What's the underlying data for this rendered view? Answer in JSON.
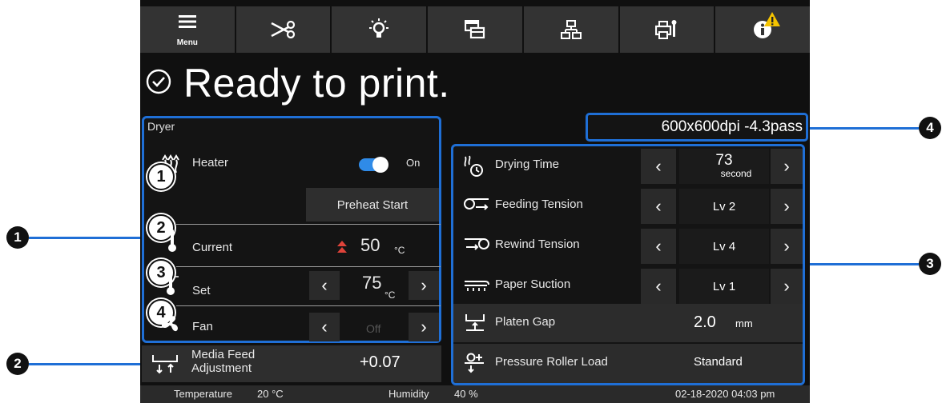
{
  "toolbar": {
    "menu_label": "Menu",
    "items": [
      {
        "icon": "menu-icon"
      },
      {
        "icon": "scissors-icon"
      },
      {
        "icon": "heater-lamp-icon"
      },
      {
        "icon": "media-settings-icon"
      },
      {
        "icon": "network-icon"
      },
      {
        "icon": "maintenance-icon"
      },
      {
        "icon": "info-icon"
      }
    ],
    "warning_icon": "warning-triangle-icon",
    "warning_color": "#f5c400"
  },
  "status": {
    "icon": "check-circle-icon",
    "text": "Ready to print."
  },
  "dryer": {
    "title": "Dryer",
    "heater": {
      "label": "Heater",
      "toggle_state": "On",
      "toggle_on": true
    },
    "preheat_button": "Preheat Start",
    "current": {
      "label": "Current",
      "value": "50",
      "unit": "°C"
    },
    "set": {
      "label": "Set",
      "value": "75",
      "unit": "°C"
    },
    "fan": {
      "label": "Fan",
      "value": "Off"
    }
  },
  "media_feed": {
    "label_line1": "Media Feed",
    "label_line2": "Adjustment",
    "value": "+0.07"
  },
  "resolution": "600x600dpi -4.3pass",
  "settings": {
    "drying_time": {
      "label": "Drying Time",
      "value": "73",
      "unit": "second"
    },
    "feeding_tension": {
      "label": "Feeding Tension",
      "value": "Lv 2"
    },
    "rewind_tension": {
      "label": "Rewind Tension",
      "value": "Lv 4"
    },
    "paper_suction": {
      "label": "Paper Suction",
      "value": "Lv 1"
    },
    "platen_gap": {
      "label": "Platen Gap",
      "value": "2.0",
      "unit": "mm"
    },
    "pressure_roller": {
      "label": "Pressure Roller Load",
      "value": "Standard"
    }
  },
  "footer": {
    "temperature_label": "Temperature",
    "temperature_value": "20 °C",
    "humidity_label": "Humidity",
    "humidity_value": "40 %",
    "datetime": "02-18-2020 04:03 pm"
  },
  "callouts": {
    "panel_numbers": [
      "1",
      "2",
      "3",
      "4"
    ],
    "item_numbers": [
      "1",
      "2",
      "3",
      "4"
    ]
  },
  "colors": {
    "accent_blue": "#1f6fd6",
    "toggle_blue": "#2f8be8",
    "up_arrow_red": "#e0433a"
  }
}
